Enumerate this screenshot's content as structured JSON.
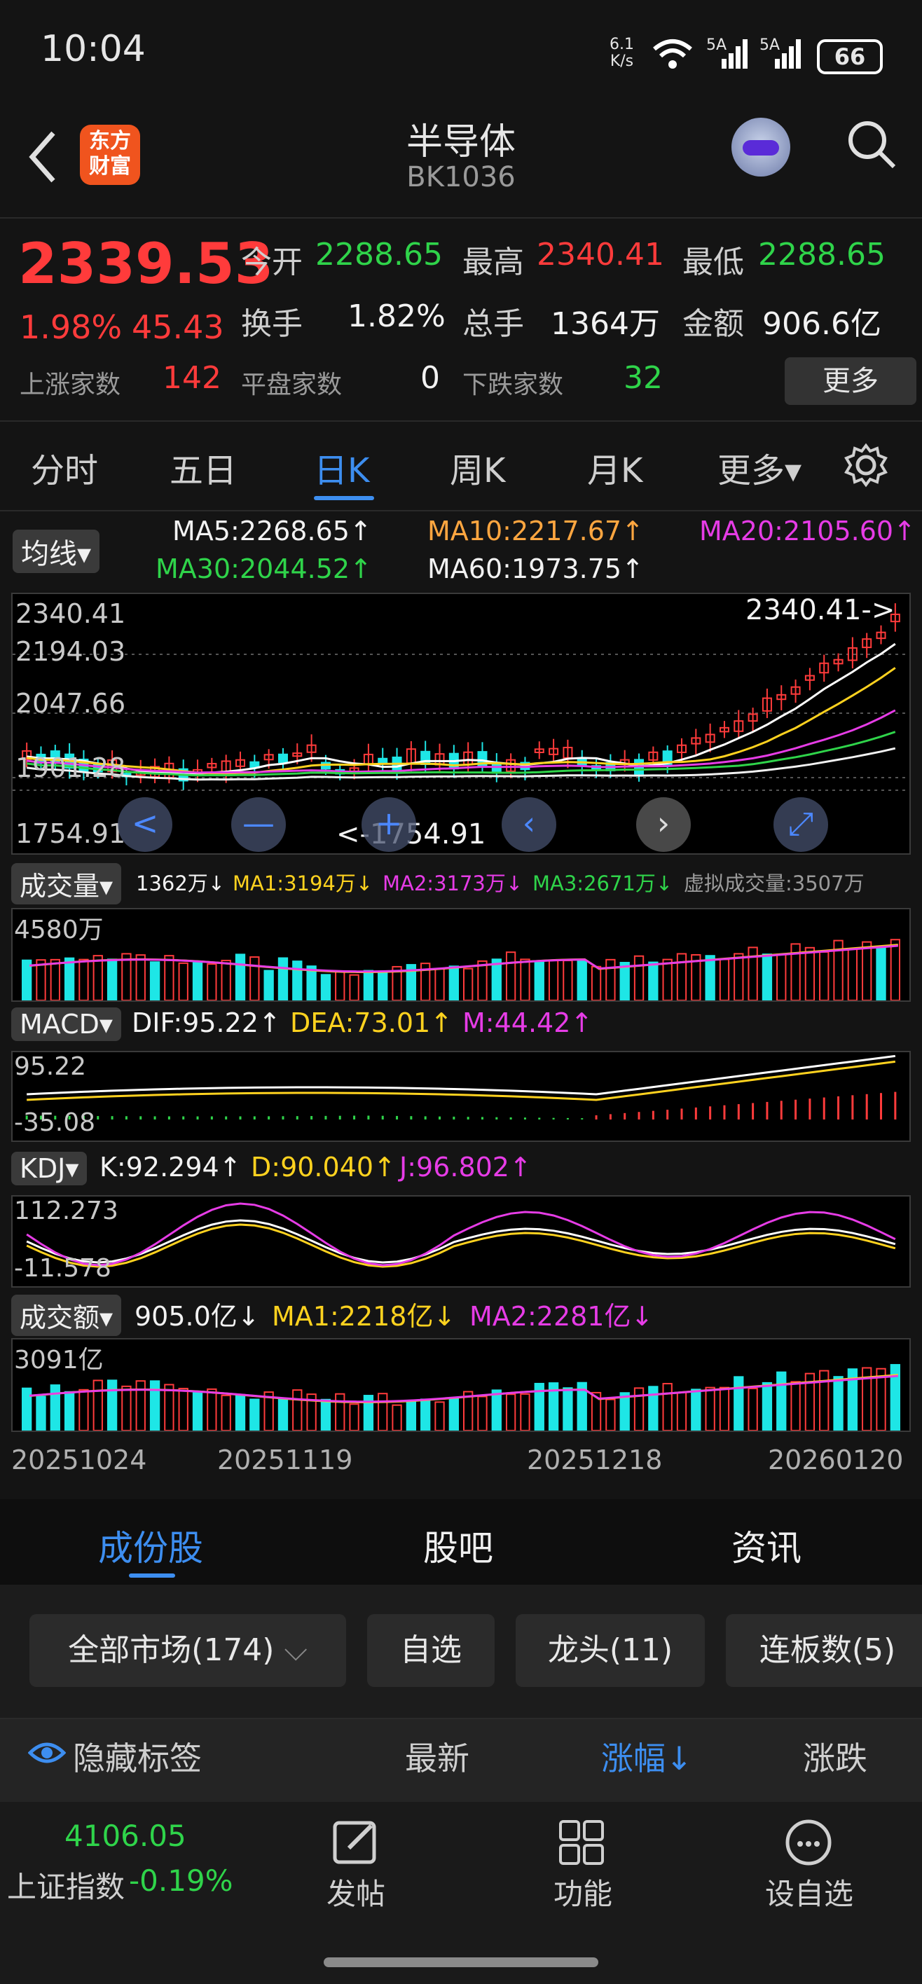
{
  "status": {
    "time": "10:04",
    "net_speed_top": "6.1",
    "net_speed_bottom": "K/s",
    "signal1": "5A",
    "signal2": "5A",
    "battery": "66"
  },
  "header": {
    "title": "半导体",
    "code": "BK1036",
    "logo_top": "东方",
    "logo_bottom": "财富"
  },
  "quote": {
    "price": "2339.53",
    "pct": "1.98%",
    "chg": "45.43",
    "open_label": "今开",
    "open": "2288.65",
    "high_label": "最高",
    "high": "2340.41",
    "low_label": "最低",
    "low": "2288.65",
    "turnover_label": "换手",
    "turnover": "1.82%",
    "volume_label": "总手",
    "volume": "1364万",
    "amount_label": "金额",
    "amount": "906.6亿",
    "up_label": "上涨家数",
    "up": "142",
    "flat_label": "平盘家数",
    "flat": "0",
    "down_label": "下跌家数",
    "down": "32",
    "more_btn": "更多"
  },
  "period_tabs": [
    "分时",
    "五日",
    "日K",
    "周K",
    "月K",
    "更多▾"
  ],
  "active_tab": 2,
  "ma": {
    "selector": "均线▾",
    "ma5": "MA5:2268.65↑",
    "ma10": "MA10:2217.67↑",
    "ma20": "MA20:2105.60↑",
    "ma30": "MA30:2044.52↑",
    "ma60": "MA60:1973.75↑"
  },
  "kline": {
    "y_labels": [
      "2340.41",
      "2194.03",
      "2047.66",
      "1901.28",
      "1754.91"
    ],
    "high_note": "2340.41->",
    "low_note": "<-1754.91",
    "colors": {
      "ma5": "#ffffff",
      "ma10": "#ffd21f",
      "ma20": "#e63ce6",
      "ma30": "#2fd44a",
      "ma60": "#f2f2f2",
      "up": "#ff3b3b",
      "down": "#1ee6e6"
    }
  },
  "volume": {
    "selector": "成交量▾",
    "value": "1362万↓",
    "ma1": "MA1:3194万↓",
    "ma2": "MA2:3173万↓",
    "ma3": "MA3:2671万↓",
    "virtual": "虚拟成交量:3507万",
    "max_label": "4580万"
  },
  "macd": {
    "selector": "MACD▾",
    "dif": "DIF:95.22↑",
    "dea": "DEA:73.01↑",
    "m": "M:44.42↑",
    "top": "95.22",
    "bottom": "-35.08"
  },
  "kdj": {
    "selector": "KDJ▾",
    "k": "K:92.294↑",
    "d": "D:90.040↑",
    "j": "J:96.802↑",
    "top": "112.273",
    "bottom": "-11.578"
  },
  "amount": {
    "selector": "成交额▾",
    "value": "905.0亿↓",
    "ma1": "MA1:2218亿↓",
    "ma2": "MA2:2281亿↓",
    "max_label": "3091亿"
  },
  "dates": [
    "20251024",
    "20251119",
    "20251218",
    "20260120"
  ],
  "content_tabs": [
    "成份股",
    "股吧",
    "资讯"
  ],
  "filters": [
    "全部市场(174)",
    "自选",
    "龙头(11)",
    "连板数(5)"
  ],
  "list_header": {
    "hide": "隐藏标签",
    "latest": "最新",
    "change_pct": "涨幅↓",
    "change": "涨跌"
  },
  "index": {
    "value": "4106.05",
    "name": "上证指数",
    "pct": "-0.19%"
  },
  "bottom_nav": [
    "发帖",
    "功能",
    "设自选"
  ]
}
